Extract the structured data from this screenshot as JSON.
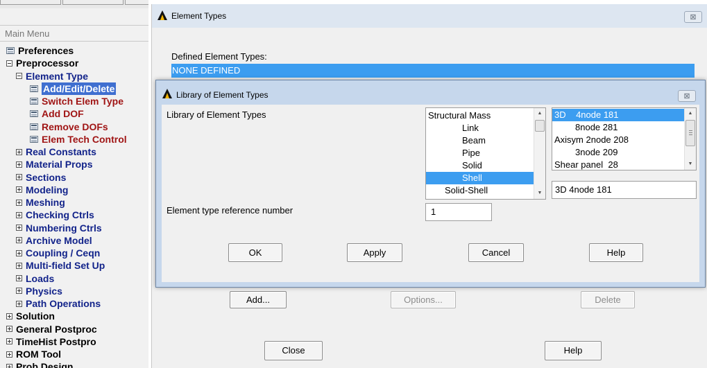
{
  "main_menu": {
    "header": "Main Menu",
    "items": [
      {
        "label": "Preferences",
        "icon": "command-icon",
        "color": "black"
      },
      {
        "label": "Preprocessor",
        "icon": "collapse-icon",
        "color": "black"
      },
      {
        "label": "Element Type",
        "icon": "collapse-icon",
        "color": "navy"
      },
      {
        "label": "Add/Edit/Delete",
        "icon": "command-icon",
        "color": "selected"
      },
      {
        "label": "Switch Elem Type",
        "icon": "command-icon",
        "color": "red"
      },
      {
        "label": "Add DOF",
        "icon": "command-icon",
        "color": "red"
      },
      {
        "label": "Remove DOFs",
        "icon": "command-icon",
        "color": "red"
      },
      {
        "label": "Elem Tech Control",
        "icon": "command-icon",
        "color": "red"
      },
      {
        "label": "Real Constants",
        "icon": "expand-icon",
        "color": "navy"
      },
      {
        "label": "Material Props",
        "icon": "expand-icon",
        "color": "navy"
      },
      {
        "label": "Sections",
        "icon": "expand-icon",
        "color": "navy"
      },
      {
        "label": "Modeling",
        "icon": "expand-icon",
        "color": "navy"
      },
      {
        "label": "Meshing",
        "icon": "expand-icon",
        "color": "navy"
      },
      {
        "label": "Checking Ctrls",
        "icon": "expand-icon",
        "color": "navy"
      },
      {
        "label": "Numbering Ctrls",
        "icon": "expand-icon",
        "color": "navy"
      },
      {
        "label": "Archive Model",
        "icon": "expand-icon",
        "color": "navy"
      },
      {
        "label": "Coupling / Ceqn",
        "icon": "expand-icon",
        "color": "navy"
      },
      {
        "label": "Multi-field Set Up",
        "icon": "expand-icon",
        "color": "navy"
      },
      {
        "label": "Loads",
        "icon": "expand-icon",
        "color": "navy"
      },
      {
        "label": "Physics",
        "icon": "expand-icon",
        "color": "navy"
      },
      {
        "label": "Path Operations",
        "icon": "expand-icon",
        "color": "navy"
      },
      {
        "label": "Solution",
        "icon": "expand-icon",
        "color": "black"
      },
      {
        "label": "General Postproc",
        "icon": "expand-icon",
        "color": "black"
      },
      {
        "label": "TimeHist Postpro",
        "icon": "expand-icon",
        "color": "black"
      },
      {
        "label": "ROM Tool",
        "icon": "expand-icon",
        "color": "black"
      },
      {
        "label": "Prob Design",
        "icon": "expand-icon",
        "color": "black"
      }
    ]
  },
  "element_types_dialog": {
    "title": "Element Types",
    "close_glyph": "⊠",
    "defined_label": "Defined Element Types:",
    "defined_value": "NONE DEFINED",
    "add_label": "Add...",
    "options_label": "Options...",
    "delete_label": "Delete",
    "close_label": "Close",
    "help_label": "Help"
  },
  "library_dialog": {
    "title": "Library of Element Types",
    "close_glyph": "⊠",
    "library_label": "Library of Element Types",
    "categories": [
      "Structural Mass",
      "Link",
      "Beam",
      "Pipe",
      "Solid",
      "Shell",
      "Solid-Shell"
    ],
    "selected_category": "Shell",
    "elements": [
      "3D    4node 181",
      "8node 281",
      "Axisym 2node 208",
      "3node 209",
      "Shear panel  28"
    ],
    "selected_element": "3D    4node 181",
    "selected_element_display": "3D     4node 181",
    "ref_number_label": "Element type reference number",
    "ref_number_value": "1",
    "ok_label": "OK",
    "apply_label": "Apply",
    "cancel_label": "Cancel",
    "help_label": "Help"
  },
  "colors": {
    "selection_blue": "#3c9df0",
    "menu_navy": "#12238a",
    "menu_red": "#a01515",
    "titlebar_active": "#c6d7ec"
  }
}
